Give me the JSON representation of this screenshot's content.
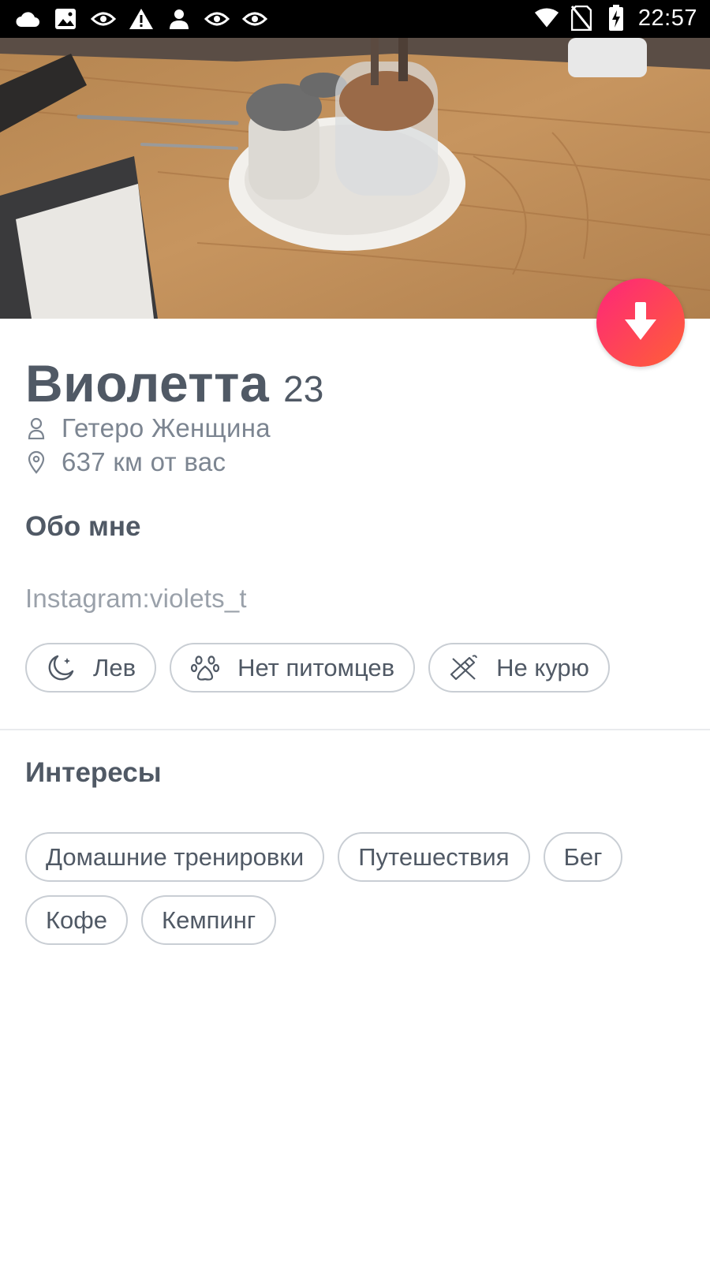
{
  "status_bar": {
    "left_icons": [
      "cloud-icon",
      "image-icon",
      "eye-icon",
      "warning-icon",
      "person-icon",
      "eye-icon",
      "eye-icon"
    ],
    "right_icons": [
      "wifi-icon",
      "no-sim-icon",
      "battery-charging-icon"
    ],
    "time": "22:57"
  },
  "photo": {
    "icon": "restaurant-table-photo"
  },
  "fab": {
    "icon": "arrow-down-icon",
    "colors": [
      "#fd267a",
      "#ff6036"
    ]
  },
  "profile": {
    "name": "Виолетта",
    "age": "23",
    "orientation": "Гетеро Женщина",
    "distance": "637 км от вас"
  },
  "about": {
    "title": "Обо мне",
    "bio": "Instagram:violets_t",
    "chips": [
      {
        "icon": "moon-icon",
        "label": "Лев"
      },
      {
        "icon": "paw-icon",
        "label": "Нет питомцев"
      },
      {
        "icon": "cigarette-icon",
        "label": "Не курю"
      }
    ]
  },
  "interests": {
    "title": "Интересы",
    "items": [
      "Домашние тренировки",
      "Путешествия",
      "Бег",
      "Кофе",
      "Кемпинг"
    ]
  }
}
